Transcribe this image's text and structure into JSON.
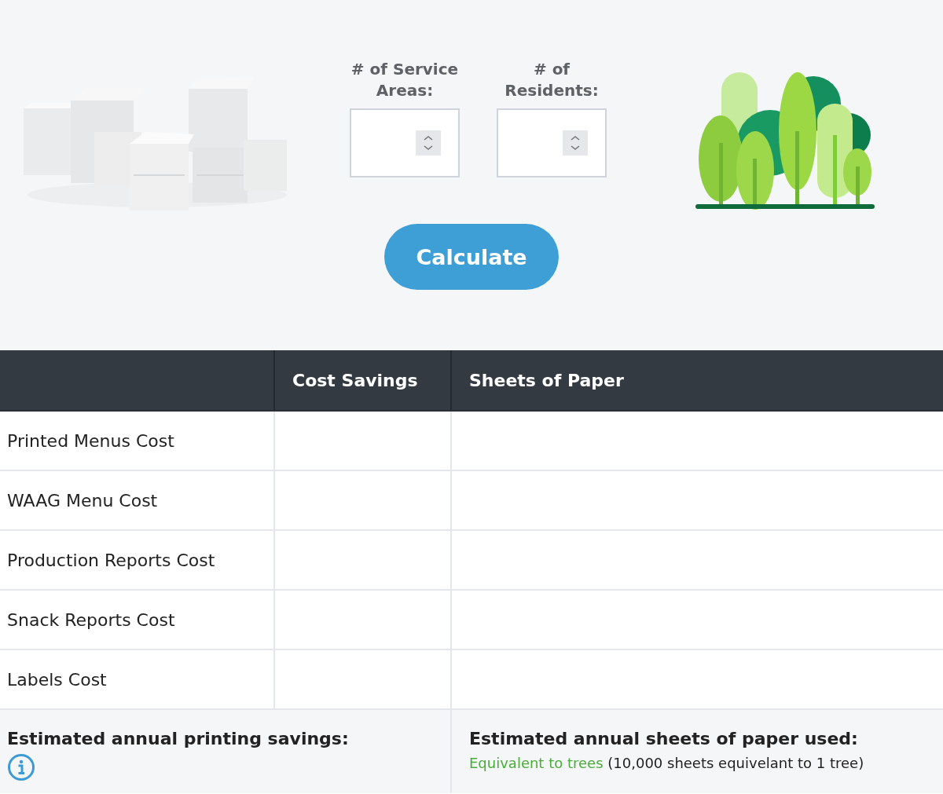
{
  "inputs": [
    {
      "label": "# of Service Areas:"
    },
    {
      "label": "# of Residents:"
    }
  ],
  "calculate_button": "Calculate",
  "table": {
    "columns": [
      "Cost Savings",
      "Sheets of Paper"
    ],
    "rows": [
      {
        "label": "Printed Menus Cost"
      },
      {
        "label": "WAAG Menu Cost"
      },
      {
        "label": "Production Reports Cost"
      },
      {
        "label": "Snack Reports Cost"
      },
      {
        "label": "Labels Cost"
      }
    ]
  },
  "summary": {
    "savings_title": "Estimated annual printing savings:",
    "sheets_title": "Estimated annual sheets of paper used:",
    "trees_text": "Equivalent to trees",
    "trees_note": "(10,000 sheets equivelant to 1 tree)"
  }
}
